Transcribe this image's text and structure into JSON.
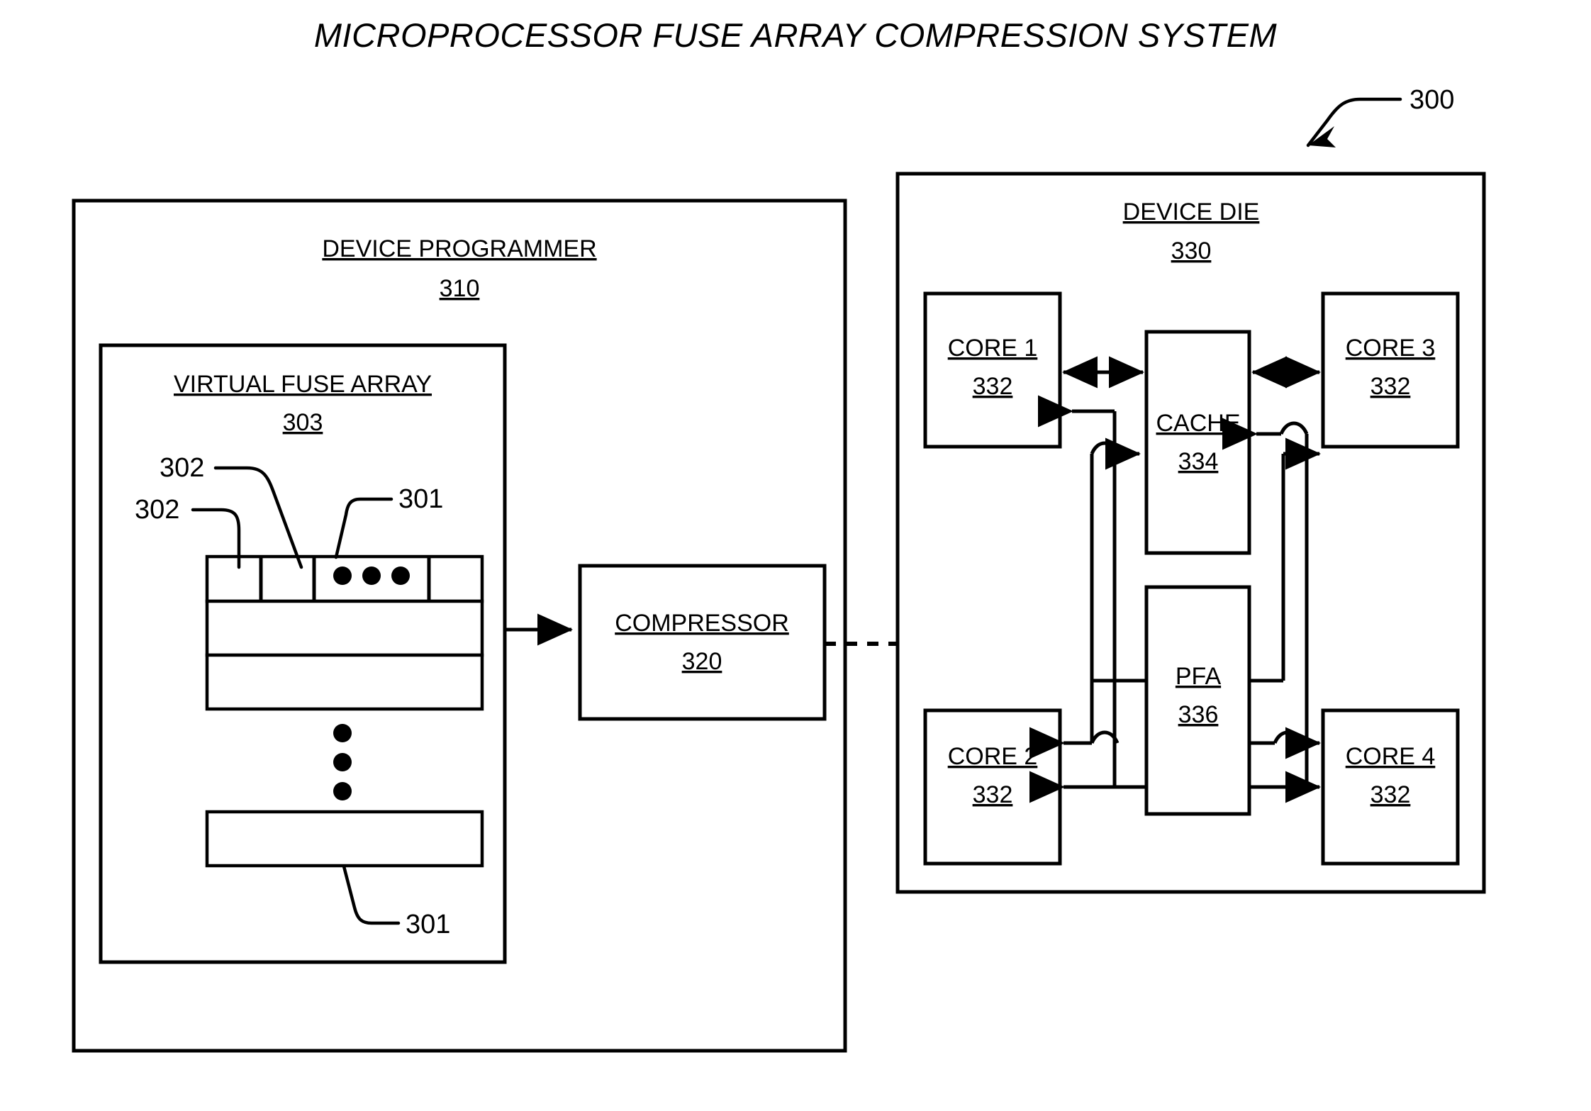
{
  "figure": {
    "title": "MICROPROCESSOR FUSE ARRAY COMPRESSION SYSTEM",
    "system_ref": "300"
  },
  "device_programmer": {
    "label": "DEVICE PROGRAMMER",
    "ref": "310"
  },
  "virtual_fuse_array": {
    "label": "VIRTUAL FUSE ARRAY",
    "ref": "303",
    "row_ref_top": "301",
    "row_ref_bottom": "301",
    "cell_ref_a": "302",
    "cell_ref_b": "302",
    "horizontal_ellipsis": "•••",
    "vertical_ellipsis": "•••"
  },
  "compressor": {
    "label": "COMPRESSOR",
    "ref": "320"
  },
  "device_die": {
    "label": "DEVICE DIE",
    "ref": "330"
  },
  "blocks": {
    "core1": {
      "label": "CORE 1",
      "ref": "332"
    },
    "core2": {
      "label": "CORE 2",
      "ref": "332"
    },
    "core3": {
      "label": "CORE 3",
      "ref": "332"
    },
    "core4": {
      "label": "CORE 4",
      "ref": "332"
    },
    "cache": {
      "label": "CACHE",
      "ref": "334"
    },
    "pfa": {
      "label": "PFA",
      "ref": "336"
    }
  },
  "colors": {
    "stroke": "#000000",
    "background": "#ffffff"
  }
}
